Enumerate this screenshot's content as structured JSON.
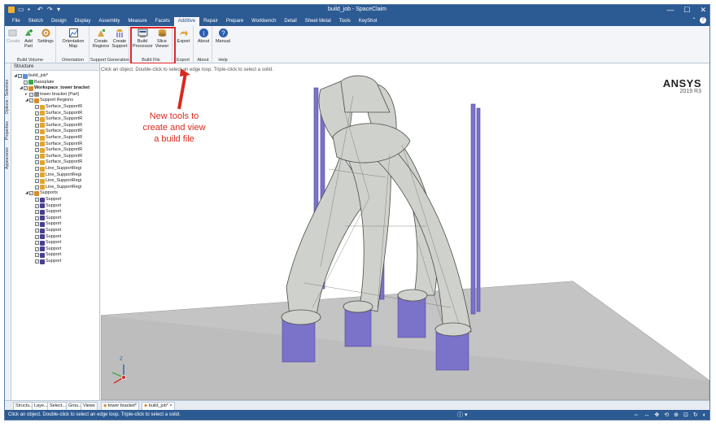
{
  "window": {
    "title": "build_job - SpaceClaim",
    "controls": [
      "—",
      "☐",
      "✕"
    ]
  },
  "menu": {
    "tabs": [
      "File",
      "Sketch",
      "Design",
      "Display",
      "Assembly",
      "Measure",
      "Facets",
      "Additive",
      "Repair",
      "Prepare",
      "Workbench",
      "Detail",
      "Sheet Metal",
      "Tools",
      "KeyShot"
    ],
    "active": "Additive"
  },
  "ribbon": {
    "create_label": "Create",
    "add_part_label": "Add\nPart",
    "settings_label": "Settings",
    "build_volume_group": "Build Volume",
    "orientation_map_label": "Orientation\nMap",
    "orientation_group": "Orientation",
    "create_regions_label": "Create\nRegions",
    "create_support_label": "Create\nSupport",
    "support_generation_group": "Support Generation",
    "build_processor_label": "Build\nProcessor",
    "slice_viewer_label": "Slice\nViewer",
    "build_file_group": "Build File",
    "export_label": "Export",
    "export_group": "Export",
    "about_label": "About",
    "about_group": "About",
    "manual_label": "Manual",
    "help_group": "Help"
  },
  "viewport": {
    "hint": "Click an object. Double-click to select an edge loop. Triple-click to select a solid.",
    "brand": "ANSYS",
    "version": "2019 R3",
    "annotation": "New tools to\ncreate and view\na build file",
    "triad_z": "Z"
  },
  "sidetabs": [
    "Options - Selection",
    "Properties",
    "Appearance"
  ],
  "structure": {
    "title": "Structure",
    "rows": [
      {
        "level": 0,
        "toggle": "◢",
        "label": "build_job*",
        "bold": false,
        "icon": "#5b8fd1"
      },
      {
        "level": 1,
        "toggle": "",
        "label": "Baseplate",
        "bold": false,
        "icon": "#3aa84a"
      },
      {
        "level": 1,
        "toggle": "◢",
        "label": "Workspace_tower bracket",
        "bold": true,
        "icon": "#d88a2b"
      },
      {
        "level": 2,
        "toggle": "▸",
        "label": "tower bracket (Part)",
        "bold": false,
        "icon": "#8a8a8a"
      },
      {
        "level": 2,
        "toggle": "◢",
        "label": "Support Regions",
        "bold": false,
        "icon": "#d88a2b"
      },
      {
        "level": 3,
        "toggle": "",
        "label": "Surface_SupportR",
        "bold": false,
        "icon": "#e3a52c"
      },
      {
        "level": 3,
        "toggle": "",
        "label": "Surface_SupportR",
        "bold": false,
        "icon": "#e3a52c"
      },
      {
        "level": 3,
        "toggle": "",
        "label": "Surface_SupportR",
        "bold": false,
        "icon": "#e3a52c"
      },
      {
        "level": 3,
        "toggle": "",
        "label": "Surface_SupportR",
        "bold": false,
        "icon": "#e3a52c"
      },
      {
        "level": 3,
        "toggle": "",
        "label": "Surface_SupportR",
        "bold": false,
        "icon": "#e3a52c"
      },
      {
        "level": 3,
        "toggle": "",
        "label": "Surface_SupportR",
        "bold": false,
        "icon": "#e3a52c"
      },
      {
        "level": 3,
        "toggle": "",
        "label": "Surface_SupportR",
        "bold": false,
        "icon": "#e3a52c"
      },
      {
        "level": 3,
        "toggle": "",
        "label": "Surface_SupportR",
        "bold": false,
        "icon": "#e3a52c"
      },
      {
        "level": 3,
        "toggle": "",
        "label": "Surface_SupportR",
        "bold": false,
        "icon": "#e3a52c"
      },
      {
        "level": 3,
        "toggle": "",
        "label": "Surface_SupportR",
        "bold": false,
        "icon": "#e3a52c"
      },
      {
        "level": 3,
        "toggle": "",
        "label": "Line_SupportRegi",
        "bold": false,
        "icon": "#e3a52c"
      },
      {
        "level": 3,
        "toggle": "",
        "label": "Line_SupportRegi",
        "bold": false,
        "icon": "#e3a52c"
      },
      {
        "level": 3,
        "toggle": "",
        "label": "Line_SupportRegi",
        "bold": false,
        "icon": "#e3a52c"
      },
      {
        "level": 3,
        "toggle": "",
        "label": "Line_SupportRegi",
        "bold": false,
        "icon": "#e3a52c"
      },
      {
        "level": 2,
        "toggle": "◢",
        "label": "Supports",
        "bold": false,
        "icon": "#d88a2b"
      },
      {
        "level": 3,
        "toggle": "",
        "label": "Support",
        "bold": false,
        "icon": "#4a3f8f"
      },
      {
        "level": 3,
        "toggle": "",
        "label": "Support",
        "bold": false,
        "icon": "#4a3f8f"
      },
      {
        "level": 3,
        "toggle": "",
        "label": "Support",
        "bold": false,
        "icon": "#4a3f8f"
      },
      {
        "level": 3,
        "toggle": "",
        "label": "Support",
        "bold": false,
        "icon": "#4a3f8f"
      },
      {
        "level": 3,
        "toggle": "",
        "label": "Support",
        "bold": false,
        "icon": "#4a3f8f"
      },
      {
        "level": 3,
        "toggle": "",
        "label": "Support",
        "bold": false,
        "icon": "#4a3f8f"
      },
      {
        "level": 3,
        "toggle": "",
        "label": "Support",
        "bold": false,
        "icon": "#4a3f8f"
      },
      {
        "level": 3,
        "toggle": "",
        "label": "Support",
        "bold": false,
        "icon": "#4a3f8f"
      },
      {
        "level": 3,
        "toggle": "",
        "label": "Support",
        "bold": false,
        "icon": "#4a3f8f"
      },
      {
        "level": 3,
        "toggle": "",
        "label": "Support",
        "bold": false,
        "icon": "#4a3f8f"
      },
      {
        "level": 3,
        "toggle": "",
        "label": "Support",
        "bold": false,
        "icon": "#4a3f8f"
      }
    ]
  },
  "bottom": {
    "panel_tabs": [
      "Structu...",
      "Laye...",
      "Select...",
      "Grou...",
      "Views"
    ],
    "doc_tabs": [
      "tower bracket*",
      "build_job*"
    ]
  },
  "status": {
    "text": "Click an object. Double-click to select an edge loop. Triple-click to select a solid.",
    "tools": [
      "⇔",
      "↔",
      "✥",
      "⟲",
      "⊕",
      "⊡",
      "↻",
      "◐"
    ]
  },
  "colors": {
    "title_blue": "#2c5a93",
    "highlight_red": "#e0262b",
    "annotation_red": "#d92a1e",
    "part_gray": "#c9ccc8",
    "support_purple": "#5c52b6"
  }
}
